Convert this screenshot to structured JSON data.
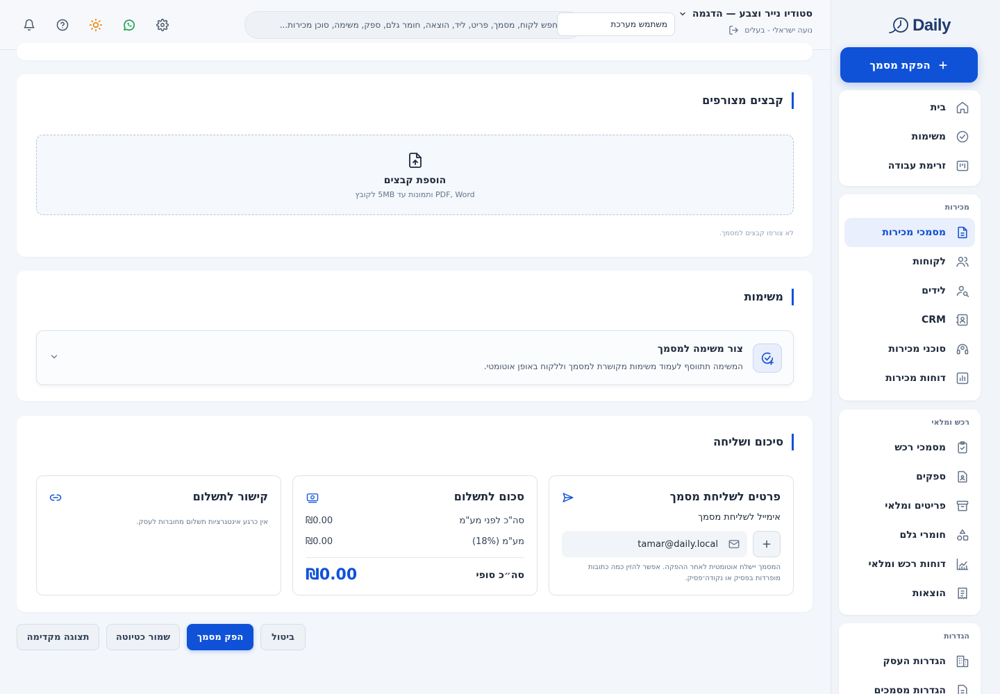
{
  "app": {
    "logo_text": "Daily"
  },
  "header": {
    "business_name": "סטודיו נייר וצבע — הדגמה",
    "user_line": "נועה ישראלי - בעלים",
    "role_value": "משתמש מערכת",
    "search_placeholder": "חפש לקוח, מסמך, פריט, ליד, הוצאה, חומר גלם, ספק, משימה, סוכן מכירות..."
  },
  "sidebar": {
    "new_doc_label": "הפקת מסמך",
    "main_items": [
      {
        "label": "בית",
        "icon": "home-icon"
      },
      {
        "label": "משימות",
        "icon": "check-circle-icon"
      },
      {
        "label": "זרימת עבודה",
        "icon": "kanban-icon"
      }
    ],
    "sales": {
      "title": "מכירות",
      "items": [
        {
          "label": "מסמכי מכירות",
          "icon": "document-icon",
          "active": true
        },
        {
          "label": "לקוחות",
          "icon": "users-icon"
        },
        {
          "label": "לידים",
          "icon": "user-search-icon"
        },
        {
          "label": "CRM",
          "icon": "contact-card-icon"
        },
        {
          "label": "סוכני מכירות",
          "icon": "headset-icon"
        },
        {
          "label": "דוחות מכירות",
          "icon": "bar-chart-icon"
        }
      ]
    },
    "purchasing": {
      "title": "רכש ומלאי",
      "items": [
        {
          "label": "מסמכי רכש",
          "icon": "clipboard-check-icon"
        },
        {
          "label": "ספקים",
          "icon": "file-user-icon"
        },
        {
          "label": "פריטים ומלאי",
          "icon": "archive-icon"
        },
        {
          "label": "חומרי גלם",
          "icon": "shapes-icon"
        },
        {
          "label": "דוחות רכש ומלאי",
          "icon": "line-chart-icon"
        },
        {
          "label": "הוצאות",
          "icon": "receipt-icon"
        }
      ]
    },
    "settings": {
      "title": "הגדרות",
      "items": [
        {
          "label": "הגדרות העסק",
          "icon": "building-icon"
        },
        {
          "label": "הגדרות מסמכים",
          "icon": "file-settings-icon"
        }
      ]
    }
  },
  "attachments": {
    "title": "קבצים מצורפים",
    "dropzone_title": "הוספת קבצים",
    "dropzone_sub": "PDF, Word ותמונות עד 5MB לקובץ",
    "empty": "לא צורפו קבצים למסמך."
  },
  "tasks": {
    "title": "משימות",
    "create_title": "צור משימה למסמך",
    "create_desc": "המשימה תתווסף לעמוד משימות מקושרת למסמך וללקוח באופן אוטומטי."
  },
  "summary": {
    "title": "סיכום ושליחה",
    "send": {
      "title": "פרטים לשליחת מסמך",
      "email_label": "אימייל לשליחת מסמך",
      "email_value": "tamar@daily.local",
      "note": "המסמך יישלח אוטומטית לאחר ההפקה. אפשר להזין כמה כתובות מופרדות בפסיק או נקודה־פסיק."
    },
    "amount": {
      "title": "סכום לתשלום",
      "pre_vat_label": "סה\"כ לפני מע\"מ",
      "pre_vat_value": "₪0.00",
      "vat_label": "מע\"מ (18%)",
      "vat_value": "₪0.00",
      "total_label": "סה״כ סופי",
      "total_value": "₪0.00"
    },
    "payment": {
      "title": "קישור לתשלום",
      "note": "אין כרגע אינטגרציות תשלום מחוברות לעסק."
    }
  },
  "actions": {
    "cancel": "ביטול",
    "issue": "הפק מסמך",
    "save_draft": "שמור כטיוטה",
    "preview": "תצוגה מקדימה"
  },
  "colors": {
    "accent": "#0f52d8",
    "whatsapp": "#16a34a",
    "sun": "#e8870e"
  }
}
